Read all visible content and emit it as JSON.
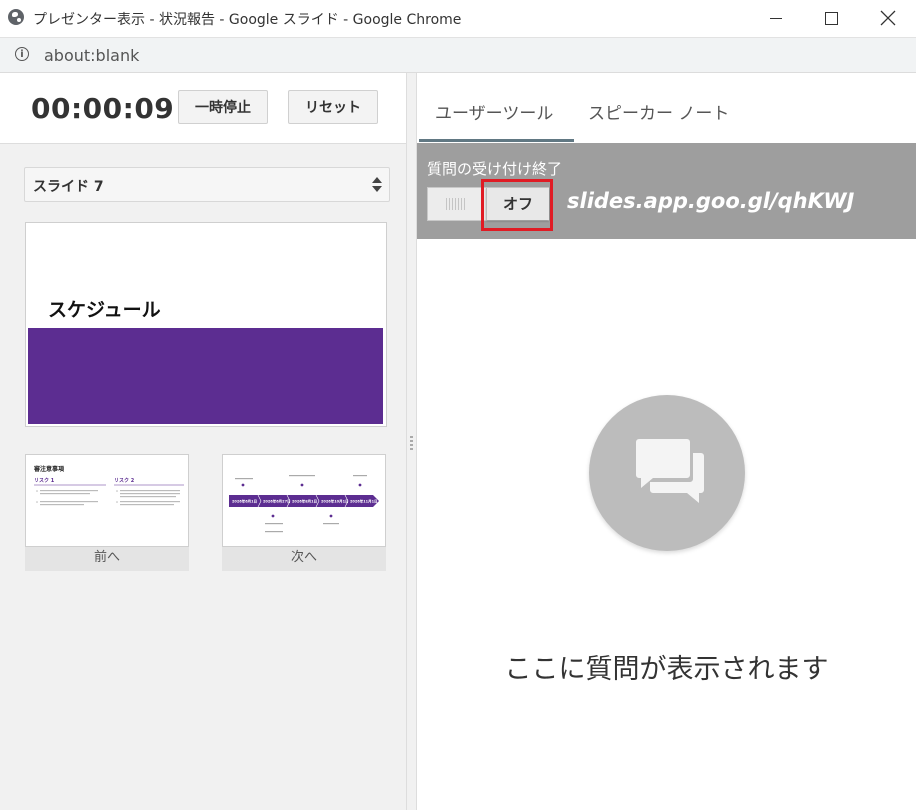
{
  "window": {
    "title": "プレゼンター表示 - 状況報告 - Google スライド - Google Chrome",
    "address": "about:blank"
  },
  "timer": {
    "elapsed": "00:00:09",
    "pause_label": "一時停止",
    "reset_label": "リセット"
  },
  "slide_select": {
    "selected": "スライド 7"
  },
  "current_slide": {
    "title": "スケジュール",
    "band_color": "#5c2d91"
  },
  "prev_thumb": {
    "heading": "審注意事項",
    "col1_title": "リスク 1",
    "col2_title": "リスク 2"
  },
  "next_thumb": {
    "dates": [
      "2026年6月1日",
      "2026年6月27日",
      "2026年8月1日",
      "2026年10月1日",
      "2026年11月1日"
    ]
  },
  "navigation": {
    "prev_label": "前へ",
    "next_label": "次へ"
  },
  "tabs": [
    {
      "label": "ユーザーツール",
      "active": true
    },
    {
      "label": "スピーカー ノート",
      "active": false
    }
  ],
  "qa": {
    "status": "質問の受け付け終了",
    "toggle_label": "オフ",
    "url": "slides.app.goo.gl/qhKWJ",
    "empty_message": "ここに質問が表示されます"
  },
  "colors": {
    "accent_purple": "#5c2d91",
    "qa_bar_gray": "#9e9e9e",
    "highlight_red": "#e01b24",
    "tab_underline": "#617883"
  }
}
